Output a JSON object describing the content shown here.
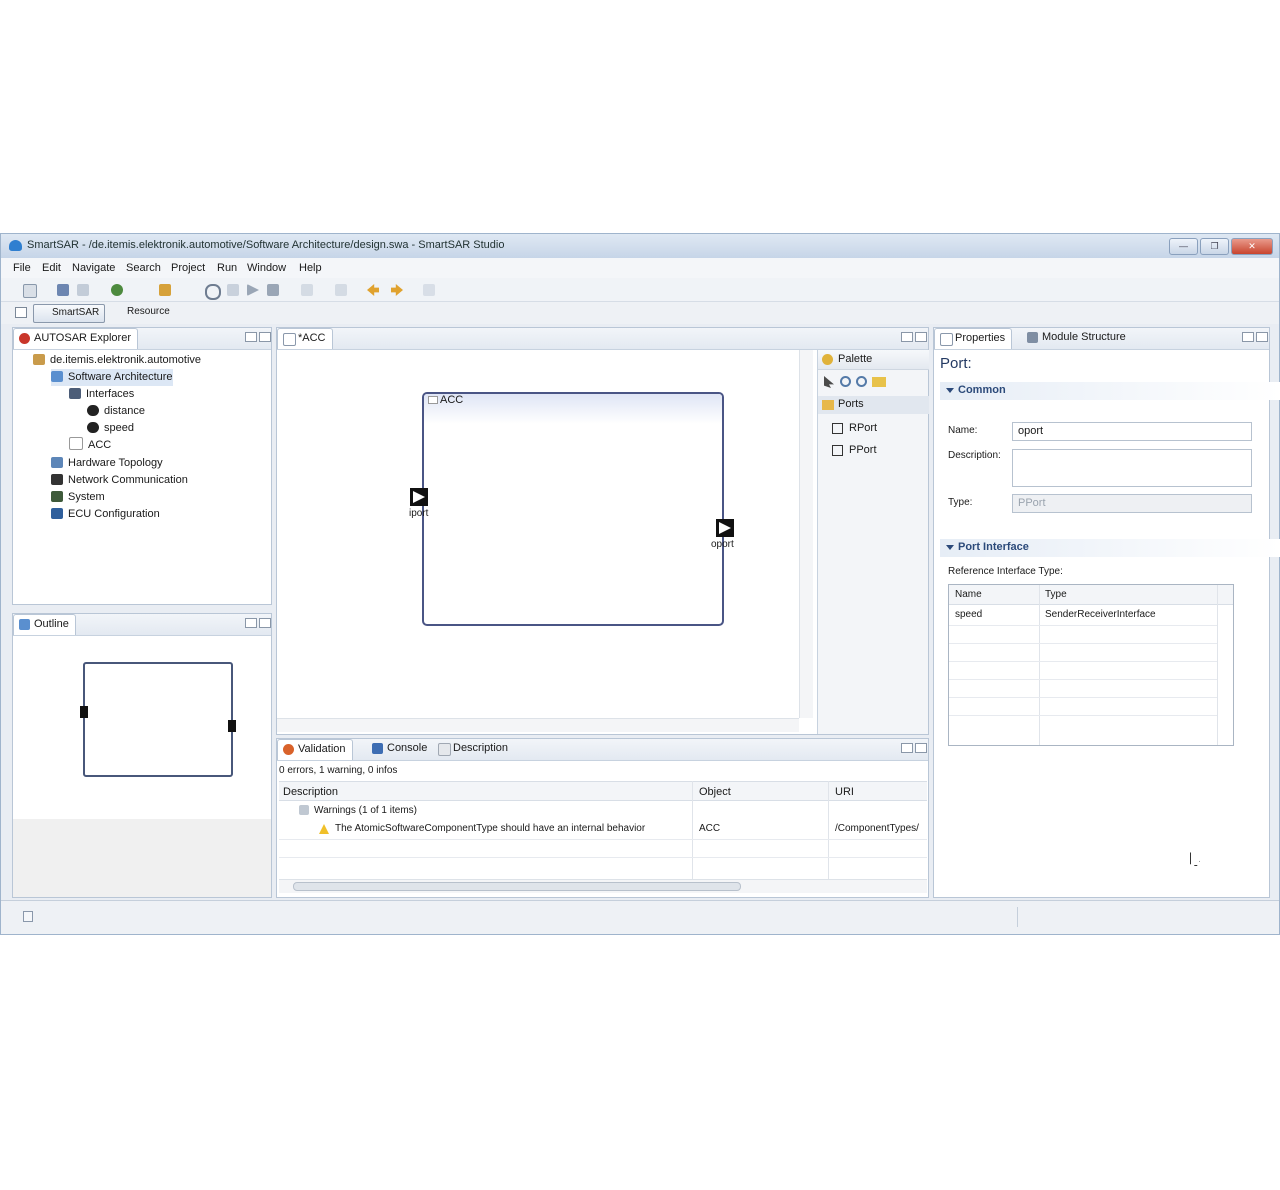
{
  "window": {
    "title": "SmartSAR - /de.itemis.elektronik.automotive/Software Architecture/design.swa - SmartSAR Studio",
    "buttons": [
      "—",
      "❐",
      "✕"
    ]
  },
  "menu": [
    "File",
    "Edit",
    "Navigate",
    "Search",
    "Project",
    "Run",
    "Window",
    "Help"
  ],
  "perspectives": {
    "active": "SmartSAR",
    "other": "Resource"
  },
  "explorer": {
    "tab": "AUTOSAR Explorer",
    "items": [
      {
        "label": "de.itemis.elektronik.automotive",
        "icon": "project-icon"
      },
      {
        "label": "Software Architecture",
        "icon": "software-architecture-icon"
      },
      {
        "label": "Interfaces",
        "icon": "interfaces-icon"
      },
      {
        "label": "distance",
        "icon": "interface-icon"
      },
      {
        "label": "speed",
        "icon": "interface-icon"
      },
      {
        "label": "ACC",
        "icon": "component-icon"
      },
      {
        "label": "Hardware Topology",
        "icon": "hardware-icon"
      },
      {
        "label": "Network Communication",
        "icon": "network-icon"
      },
      {
        "label": "System",
        "icon": "system-icon"
      },
      {
        "label": "ECU Configuration",
        "icon": "ecu-icon"
      }
    ]
  },
  "outline": {
    "tab": "Outline"
  },
  "editor": {
    "tab": "*ACC",
    "component_label": "ACC",
    "left_port_label": "iport",
    "right_port_label": "oport"
  },
  "palette": {
    "title": "Palette",
    "group": "Ports",
    "items": [
      "RPort",
      "PPort"
    ]
  },
  "validation": {
    "tabs": [
      "Validation",
      "Console",
      "Description"
    ],
    "summary": "0 errors, 1 warning, 0 infos",
    "columns": [
      "Description",
      "Object",
      "URI"
    ],
    "group": "Warnings (1 of 1 items)",
    "row": {
      "description": "The AtomicSoftwareComponentType should have an internal behavior",
      "object": "ACC",
      "uri": "/ComponentTypes/"
    }
  },
  "properties": {
    "tabs": [
      "Properties",
      "Module Structure"
    ],
    "heading": "Port:",
    "common_section": "Common",
    "name_label": "Name:",
    "name_value": "oport",
    "description_label": "Description:",
    "type_label": "Type:",
    "type_value": "PPort",
    "port_interface_section": "Port Interface",
    "reference_label": "Reference Interface Type:",
    "table_columns": [
      "Name",
      "Type"
    ],
    "table_row": {
      "name": "speed",
      "type": "SenderReceiverInterface"
    }
  }
}
